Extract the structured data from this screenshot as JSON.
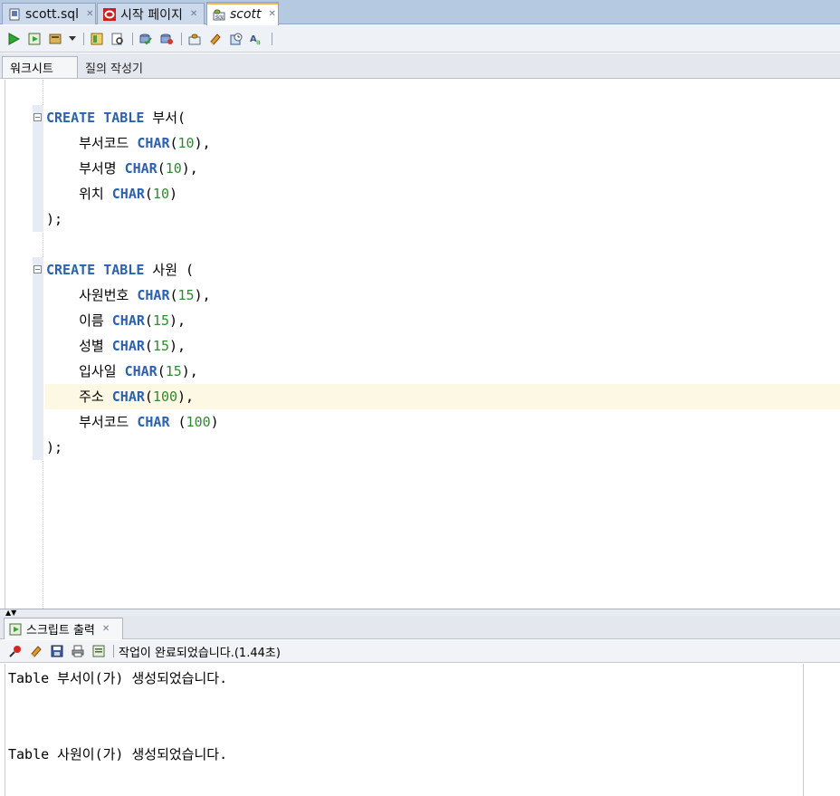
{
  "tabs": [
    {
      "label": "scott.sql",
      "icon": "sql-file-icon"
    },
    {
      "label": "시작 페이지",
      "icon": "oracle-logo-icon"
    },
    {
      "label": "scott",
      "icon": "db-connection-icon",
      "active": true
    }
  ],
  "toolbar": {
    "icons": [
      "run-statement-icon",
      "run-script-icon",
      "autotrace-icon",
      "dropdown-arrow-icon",
      "explain-plan-icon",
      "sql-tuning-icon",
      "commit-icon",
      "rollback-icon",
      "unshared-sql-icon",
      "clear-icon",
      "sql-history-icon",
      "format-icon"
    ]
  },
  "subtabs": {
    "worksheet": "워크시트",
    "query_builder": "질의 작성기"
  },
  "code": {
    "t1": {
      "create": "CREATE",
      "table": "TABLE",
      "name": "부서(",
      "c1": "부서코드",
      "c2": "부서명",
      "c3": "위치",
      "type": "CHAR",
      "p10": "(",
      "n10": "10",
      "cl": "),",
      "last": ")",
      "end": ");"
    },
    "t2": {
      "create": "CREATE",
      "table": "TABLE",
      "name": "사원 (",
      "c1": "사원번호",
      "c2": "이름",
      "c3": "성별",
      "c4": "입사일",
      "c5": "주소",
      "c6": "부서코드",
      "type": "CHAR",
      "n15": "15",
      "n100": "100",
      "end": ");"
    }
  },
  "output": {
    "tab_label": "스크립트 출력",
    "status": "작업이 완료되었습니다.(1.44초)",
    "lines": [
      "Table 부서이(가) 생성되었습니다.",
      "Table 사원이(가) 생성되었습니다."
    ]
  },
  "colors": {
    "keyword": "#2b62ad",
    "number": "#2f8a2f",
    "current_line": "#fdf8e3",
    "tab_strip": "#b5c9e1"
  }
}
